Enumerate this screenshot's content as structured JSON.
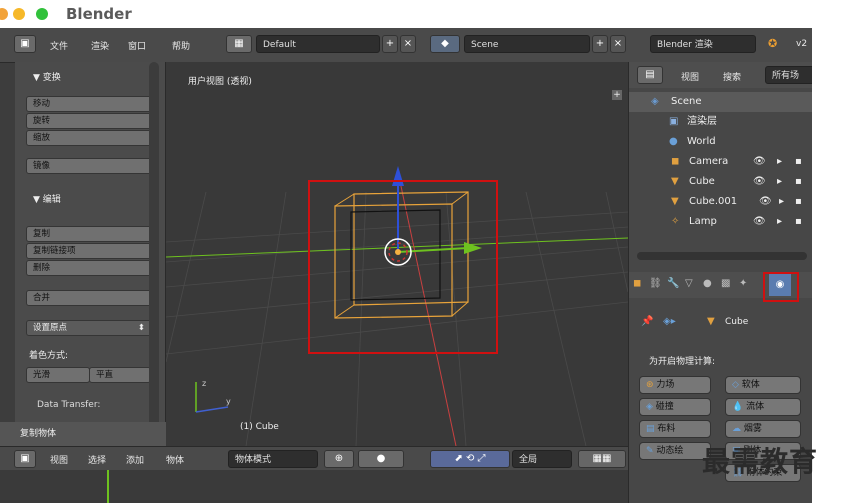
{
  "app": {
    "title": "Blender"
  },
  "menu": {
    "items": [
      "文件",
      "渲染",
      "窗口",
      "帮助"
    ]
  },
  "header": {
    "layout": "Default",
    "scene": "Scene",
    "engine": "Blender 渲染",
    "version": "v2"
  },
  "tools": {
    "transform_title": "▼ 变换",
    "transform_buttons": [
      "移动",
      "旋转",
      "缩放",
      "镜像"
    ],
    "edit_title": "▼ 编辑",
    "edit_buttons": [
      "复制",
      "复制链接项",
      "删除",
      "合并"
    ],
    "origin_select": "设置原点",
    "shading_label": "着色方式:",
    "shading_options": [
      "光滑",
      "平直"
    ],
    "data_transfer": "Data Transfer:",
    "copy_object_header": "复制物体"
  },
  "viewport": {
    "label": "用户视图 (透视)",
    "object_label": "(1) Cube"
  },
  "bottombar": {
    "items": [
      "视图",
      "选择",
      "添加",
      "物体"
    ],
    "mode": "物体模式",
    "global": "全局"
  },
  "outliner": {
    "menu": [
      "视图",
      "搜索"
    ],
    "filter": "所有场",
    "rows": [
      "Scene",
      "渲染层",
      "World",
      "Camera",
      "Cube",
      "Cube.001",
      "Lamp"
    ]
  },
  "properties": {
    "object_name": "Cube",
    "physics_label": "为开启物理计算:",
    "physics_buttons": [
      "力场",
      "软体",
      "碰撞",
      "流体",
      "布料",
      "烟雾",
      "动态绘",
      "刚体",
      "附体约束"
    ]
  },
  "watermark": "最需教育",
  "colors": {
    "highlight": "#d01010",
    "cube": "#e8a33a",
    "x_axis": "#c94040",
    "y_axis": "#6ec21f",
    "z_axis": "#2e50d8"
  }
}
